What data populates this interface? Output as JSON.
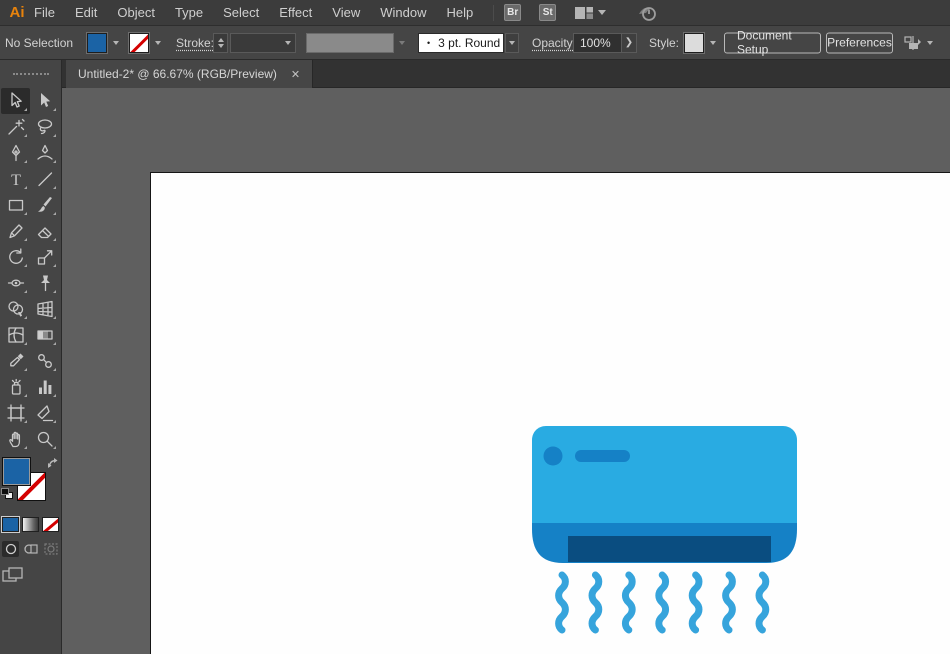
{
  "menubar": {
    "logo": "Ai",
    "items": [
      "File",
      "Edit",
      "Object",
      "Type",
      "Select",
      "Effect",
      "View",
      "Window",
      "Help"
    ],
    "bridge_badge": "Br",
    "stock_badge": "St"
  },
  "control_bar": {
    "selection_status": "No Selection",
    "stroke_label": "Stroke:",
    "brush_preview_glyph": "•",
    "brush_value": "3 pt. Round",
    "opacity_label": "Opacity:",
    "opacity_value": "100%",
    "opacity_expand_glyph": "❯",
    "style_label": "Style:",
    "document_setup_button": "Document Setup",
    "preferences_button": "Preferences"
  },
  "document_tab": {
    "title": "Untitled-2* @ 66.67% (RGB/Preview)",
    "close_glyph": "✕"
  },
  "toolbar": {
    "tools": [
      {
        "name": "selection-tool",
        "icon": "cursor-outline",
        "selected": true
      },
      {
        "name": "direct-selection-tool",
        "icon": "cursor-filled",
        "selected": false
      },
      {
        "name": "magic-wand-tool",
        "icon": "wand",
        "selected": false
      },
      {
        "name": "lasso-tool",
        "icon": "lasso",
        "selected": false
      },
      {
        "name": "pen-tool",
        "icon": "pen",
        "selected": false
      },
      {
        "name": "curvature-tool",
        "icon": "curvature",
        "selected": false
      },
      {
        "name": "type-tool",
        "icon": "type",
        "selected": false
      },
      {
        "name": "line-segment-tool",
        "icon": "line",
        "selected": false
      },
      {
        "name": "rectangle-tool",
        "icon": "rectangle",
        "selected": false
      },
      {
        "name": "paintbrush-tool",
        "icon": "brush",
        "selected": false
      },
      {
        "name": "pencil-tool",
        "icon": "pencil",
        "selected": false
      },
      {
        "name": "eraser-tool",
        "icon": "eraser",
        "selected": false
      },
      {
        "name": "rotate-tool",
        "icon": "rotate",
        "selected": false
      },
      {
        "name": "scale-tool",
        "icon": "scale",
        "selected": false
      },
      {
        "name": "width-tool",
        "icon": "width",
        "selected": false
      },
      {
        "name": "puppet-warp-tool",
        "icon": "pin",
        "selected": false
      },
      {
        "name": "shape-builder-tool",
        "icon": "shape-builder",
        "selected": false
      },
      {
        "name": "perspective-grid-tool",
        "icon": "perspective",
        "selected": false
      },
      {
        "name": "mesh-tool",
        "icon": "mesh",
        "selected": false
      },
      {
        "name": "gradient-tool",
        "icon": "gradient",
        "selected": false
      },
      {
        "name": "eyedropper-tool",
        "icon": "eyedropper",
        "selected": false
      },
      {
        "name": "blend-tool",
        "icon": "blend",
        "selected": false
      },
      {
        "name": "symbol-sprayer-tool",
        "icon": "spray",
        "selected": false
      },
      {
        "name": "column-graph-tool",
        "icon": "graph",
        "selected": false
      },
      {
        "name": "artboard-tool",
        "icon": "artboard",
        "selected": false
      },
      {
        "name": "slice-tool",
        "icon": "slice",
        "selected": false
      },
      {
        "name": "hand-tool",
        "icon": "hand",
        "selected": false
      },
      {
        "name": "zoom-tool",
        "icon": "zoom",
        "selected": false
      }
    ]
  },
  "colors": {
    "logo_orange": "#e8830c",
    "fill_swatch": "#1b63a5",
    "ac_body": "#29abe2",
    "ac_band": "#1581c6",
    "ac_vent": "#0a4d80",
    "ac_wave": "#36a4dc"
  }
}
